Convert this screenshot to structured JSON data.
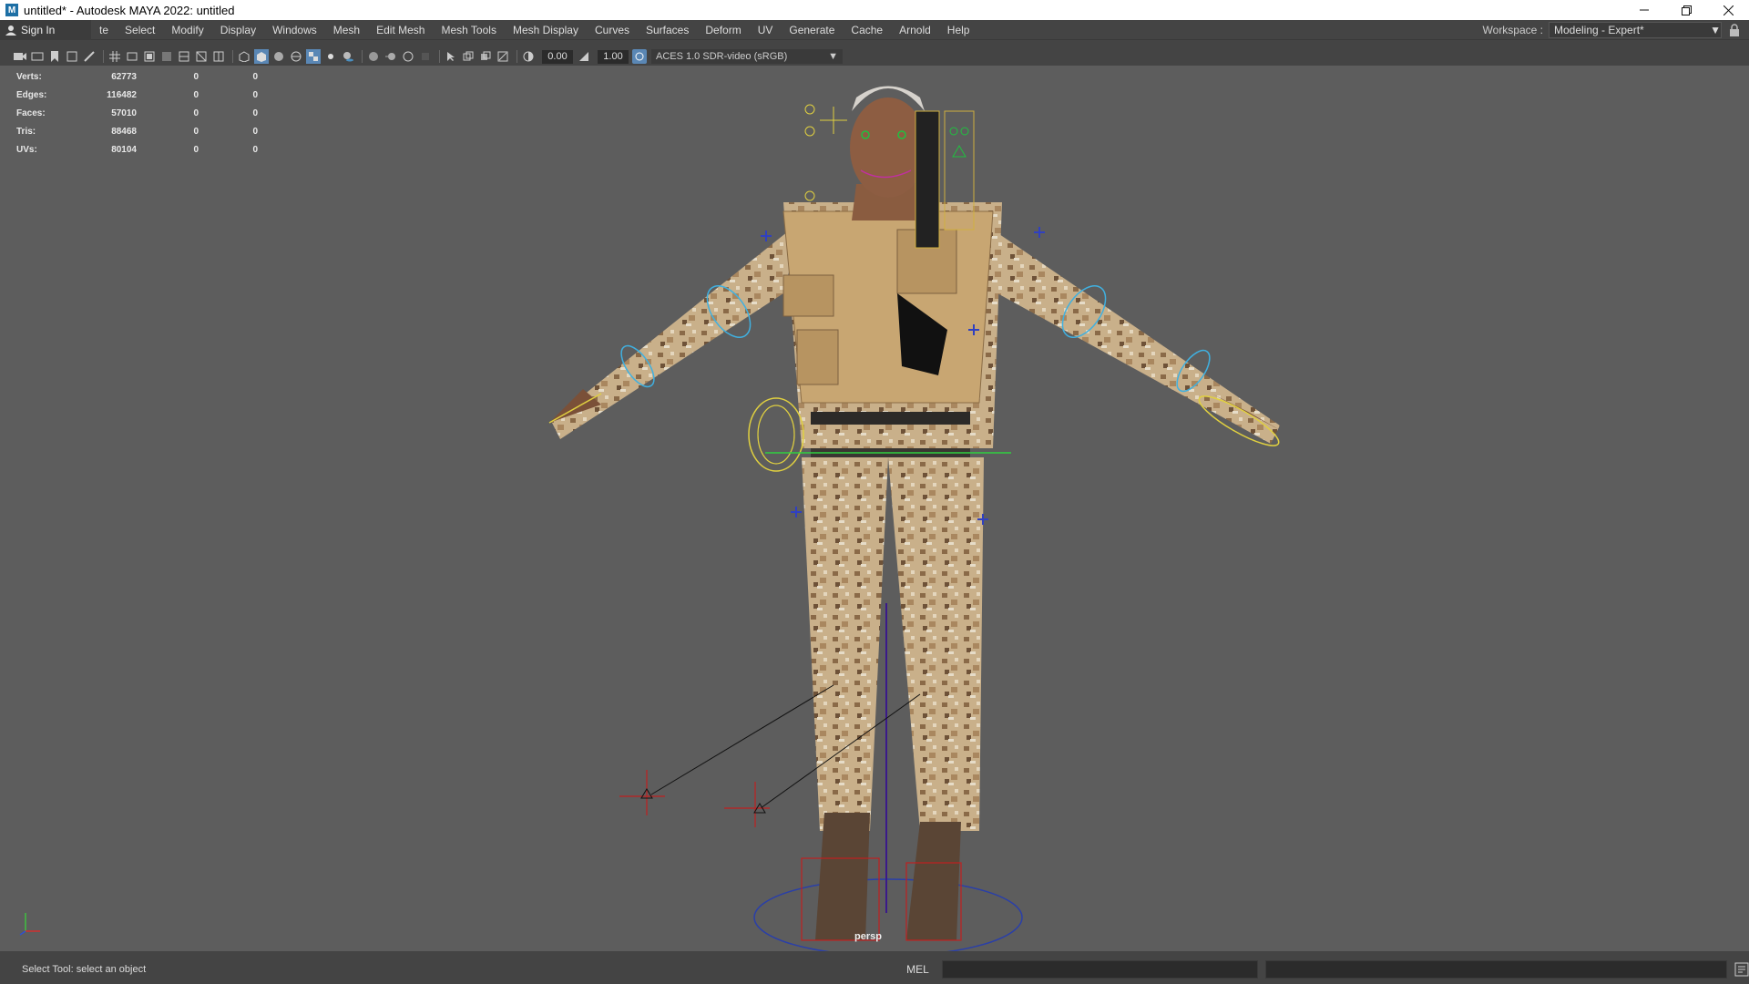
{
  "window": {
    "title": "untitled* - Autodesk MAYA 2022: untitled",
    "app_icon": "M",
    "controls": [
      "minimize-icon",
      "restore-icon",
      "close-icon"
    ]
  },
  "menubar": {
    "sign_in": "Sign In",
    "items": [
      "te",
      "Select",
      "Modify",
      "Display",
      "Windows",
      "Mesh",
      "Edit Mesh",
      "Mesh Tools",
      "Mesh Display",
      "Curves",
      "Surfaces",
      "Deform",
      "UV",
      "Generate",
      "Cache",
      "Arnold",
      "Help"
    ],
    "workspace_label": "Workspace :",
    "workspace_value": "Modeling - Expert*"
  },
  "toolbar": {
    "exposure": "0.00",
    "gamma": "1.00",
    "color_space": "ACES 1.0 SDR-video (sRGB)"
  },
  "hud": {
    "rows": [
      {
        "label": "Verts:",
        "v1": "62773",
        "v2": "0",
        "v3": "0"
      },
      {
        "label": "Edges:",
        "v1": "116482",
        "v2": "0",
        "v3": "0"
      },
      {
        "label": "Faces:",
        "v1": "57010",
        "v2": "0",
        "v3": "0"
      },
      {
        "label": "Tris:",
        "v1": "88468",
        "v2": "0",
        "v3": "0"
      },
      {
        "label": "UVs:",
        "v1": "80104",
        "v2": "0",
        "v3": "0"
      }
    ]
  },
  "viewport": {
    "camera": "persp",
    "background": "#5d5d5d"
  },
  "status": {
    "message": "Select Tool: select an object",
    "command_type": "MEL"
  }
}
